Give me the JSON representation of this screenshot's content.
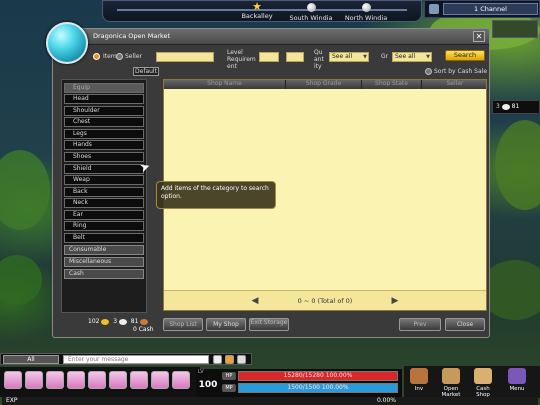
{
  "locations": [
    "Backalley",
    "South Windia",
    "North Windia"
  ],
  "channel": {
    "label": "1 Channel"
  },
  "side_money": {
    "value": "81"
  },
  "market": {
    "title": "Dragonica Open Market",
    "filters": {
      "item_label": "Item",
      "seller_label": "Seller",
      "level_label": "Level Requirement",
      "level_label_line1": "Level",
      "level_label_line2": "Requirem",
      "level_label_line3": "ent",
      "quantity_label_line1": "Qu",
      "quantity_label_line2": "ant",
      "quantity_label_line3": "ity",
      "quantity_value": "See all",
      "grade_label": "Gr",
      "grade_value": "See all",
      "search_button": "Search"
    },
    "default_button": "Default",
    "sort_cash_label": "Sort by Cash Sale",
    "categories": {
      "header": "Equip",
      "items": [
        "Head",
        "Shoulder",
        "Chest",
        "Legs",
        "Hands",
        "Shoes",
        "Shield",
        "Weap",
        "Back",
        "Neck",
        "Ear",
        "Ring",
        "Belt"
      ],
      "groups": [
        "Consumable",
        "Miscellaneous",
        "Cash"
      ]
    },
    "table": {
      "columns": [
        "Shop Name",
        "Shop Grade",
        "Shop State",
        "Seller"
      ],
      "pager": "0 ~ 0 (Total of 0)"
    },
    "footer": {
      "money_gold": "102",
      "money_silver": "3",
      "money_copper": "81",
      "cash": "0 Cash",
      "buttons": [
        "Shop List",
        "My Shop",
        "Exit Storage",
        "Prev",
        "Close"
      ]
    },
    "tooltip": "Add items of the category to search option."
  },
  "chat": {
    "mode": "All",
    "placeholder": "Enter your message"
  },
  "status": {
    "level_tag": "LV",
    "level": "100",
    "hp_tag": "HP",
    "hp": "15280/15280 100.00%",
    "mp_tag": "MP",
    "mp": "1500/1500 100.00%"
  },
  "exp": {
    "label": "EXP",
    "percent": "0.00%"
  },
  "menus": [
    "Inv",
    "Open Market",
    "Cash Shop",
    "Menu"
  ],
  "colors": {
    "hp": "#d8282c",
    "mp": "#2a9ad8",
    "table_bg": "#fbf3b2",
    "search_button": "#f0c020"
  }
}
